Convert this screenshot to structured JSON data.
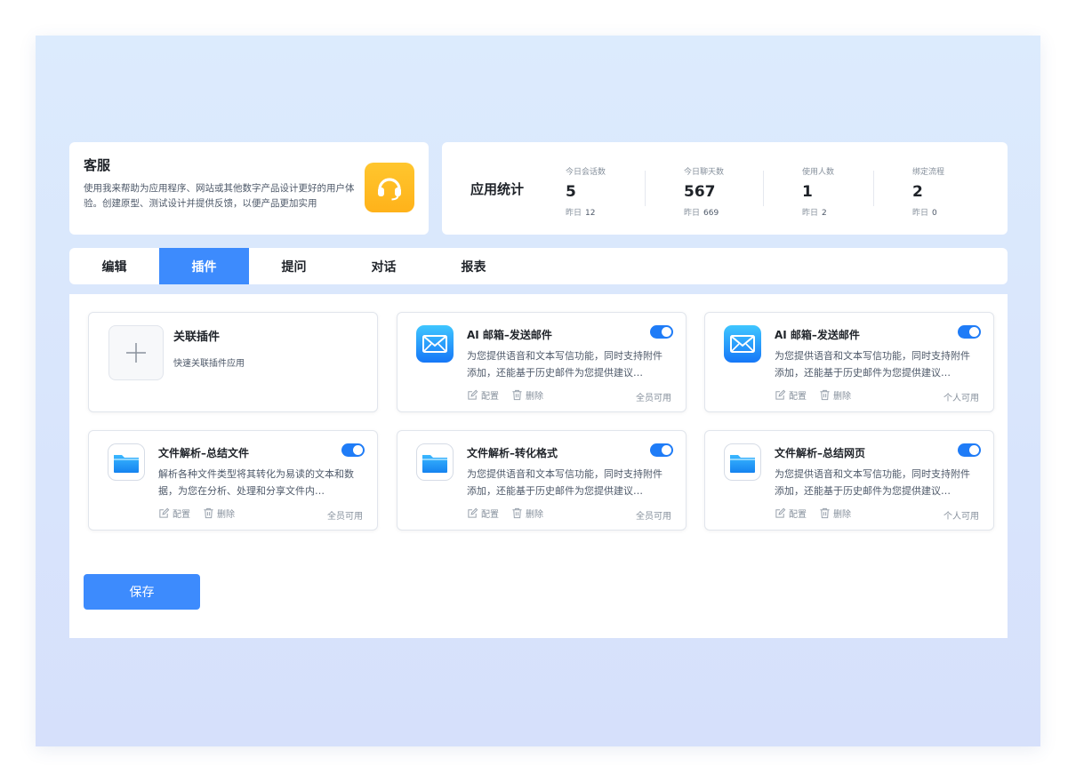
{
  "app": {
    "title": "客服",
    "description": "使用我来帮助为应用程序、网站或其他数字产品设计更好的用户体验。创建原型、测试设计并提供反馈，以便产品更加实用",
    "icon": "headset-icon",
    "accent": "#ffb21a"
  },
  "stats": {
    "title": "应用统计",
    "yesterday_label": "昨日",
    "items": [
      {
        "label": "今日会话数",
        "value": "5",
        "yesterday": "12"
      },
      {
        "label": "今日聊天数",
        "value": "567",
        "yesterday": "669"
      },
      {
        "label": "使用人数",
        "value": "1",
        "yesterday": "2"
      },
      {
        "label": "绑定流程",
        "value": "2",
        "yesterday": "0"
      }
    ]
  },
  "tabs": [
    {
      "label": "编辑",
      "active": false
    },
    {
      "label": "插件",
      "active": true
    },
    {
      "label": "提问",
      "active": false
    },
    {
      "label": "对话",
      "active": false
    },
    {
      "label": "报表",
      "active": false
    }
  ],
  "add_plugin": {
    "title": "关联插件",
    "description": "快速关联插件应用"
  },
  "actions": {
    "config": "配置",
    "delete": "删除"
  },
  "plugins": [
    {
      "name": "AI 邮箱–发送邮件",
      "icon": "mail-icon",
      "description": "为您提供语音和文本写信功能，同时支持附件添加，还能基于历史邮件为您提供建议…",
      "enabled": true,
      "scope": "全员可用"
    },
    {
      "name": "AI 邮箱–发送邮件",
      "icon": "mail-icon",
      "description": "为您提供语音和文本写信功能，同时支持附件添加，还能基于历史邮件为您提供建议…",
      "enabled": true,
      "scope": "个人可用"
    },
    {
      "name": "文件解析–总结文件",
      "icon": "folder-icon",
      "description": "解析各种文件类型将其转化为易读的文本和数据，为您在分析、处理和分享文件内…",
      "enabled": true,
      "scope": "全员可用"
    },
    {
      "name": "文件解析–转化格式",
      "icon": "folder-icon",
      "description": "为您提供语音和文本写信功能，同时支持附件添加，还能基于历史邮件为您提供建议…",
      "enabled": true,
      "scope": "全员可用"
    },
    {
      "name": "文件解析–总结网页",
      "icon": "folder-icon",
      "description": "为您提供语音和文本写信功能，同时支持附件添加，还能基于历史邮件为您提供建议…",
      "enabled": true,
      "scope": "个人可用"
    }
  ],
  "save_label": "保存",
  "colors": {
    "primary": "#3d8bfd",
    "toggle_on": "#1f7cf7"
  }
}
